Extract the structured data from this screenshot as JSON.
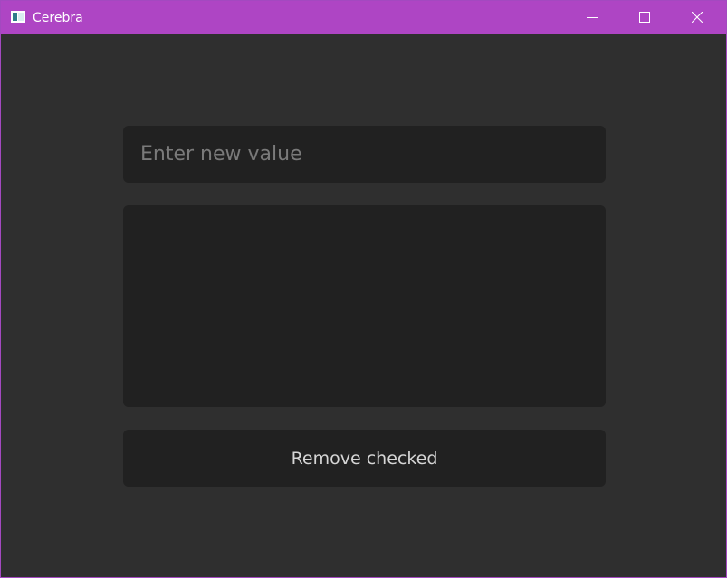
{
  "window": {
    "title": "Cerebra",
    "icon": "app-window-icon",
    "controls": {
      "minimize_icon": "minimize-icon",
      "maximize_icon": "maximize-icon",
      "close_icon": "close-icon"
    },
    "accent_color": "#ae45c4"
  },
  "main": {
    "input": {
      "value": "",
      "placeholder": "Enter new value"
    },
    "list": {
      "items": []
    },
    "remove_button": {
      "label": "Remove checked"
    }
  }
}
